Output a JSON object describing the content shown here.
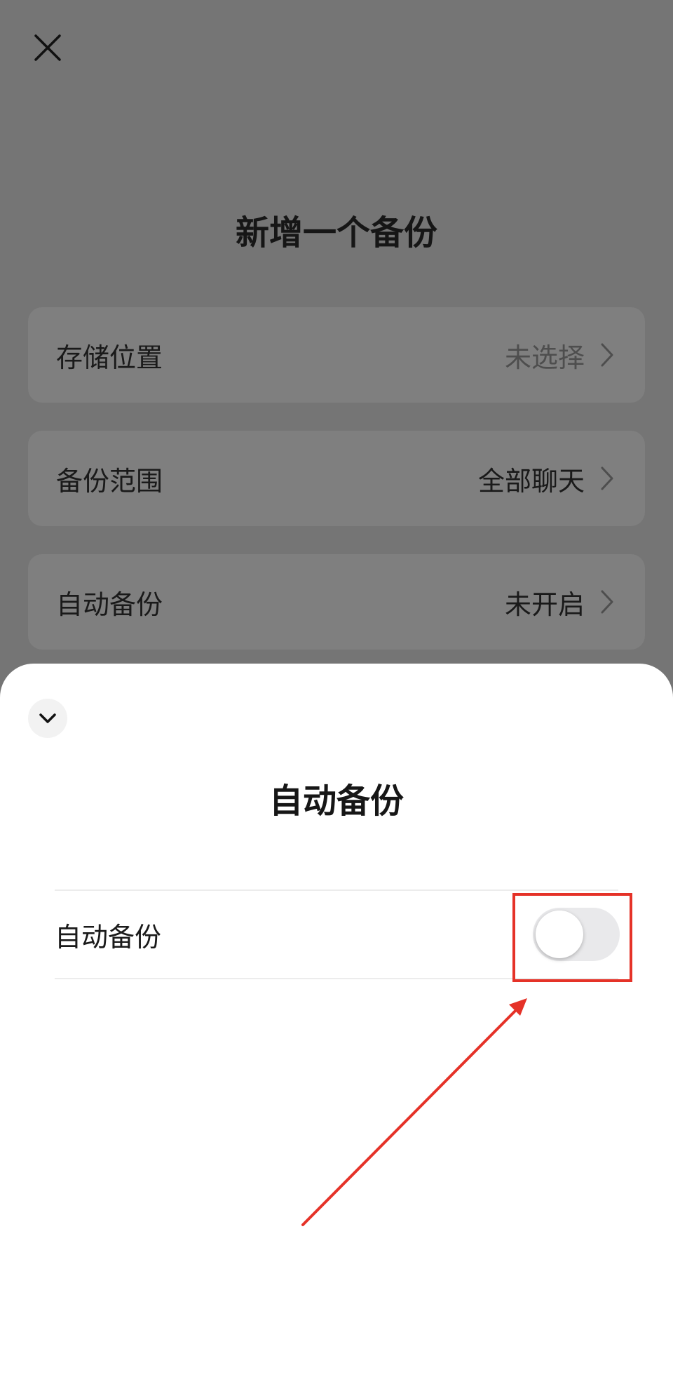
{
  "page": {
    "title": "新增一个备份",
    "rows": [
      {
        "label": "存储位置",
        "value": "未选择",
        "muted": true
      },
      {
        "label": "备份范围",
        "value": "全部聊天",
        "muted": false
      },
      {
        "label": "自动备份",
        "value": "未开启",
        "muted": false
      }
    ]
  },
  "sheet": {
    "title": "自动备份",
    "toggle_label": "自动备份",
    "toggle_on": false
  },
  "colors": {
    "overlay_bg": "#757575",
    "annotation": "#e53228"
  },
  "icons": {
    "close": "close-icon",
    "chevron_right": "chevron-right-icon",
    "collapse": "chevron-down-icon"
  }
}
